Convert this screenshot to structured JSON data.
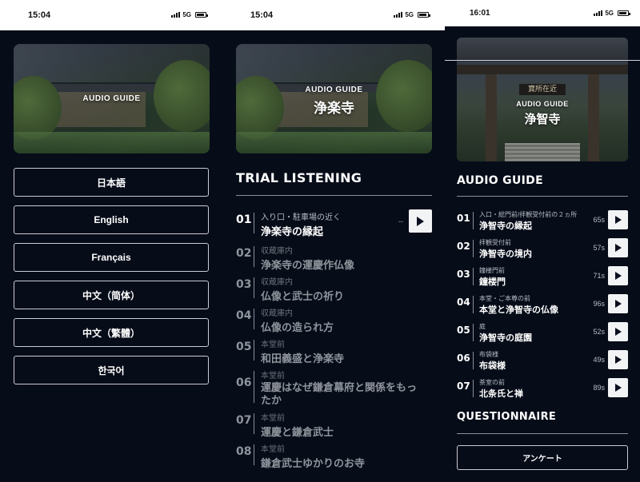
{
  "screen1": {
    "status": {
      "time": "15:04",
      "network": "5G"
    },
    "hero": {
      "label": "AUDIO GUIDE"
    },
    "languages": [
      "日本語",
      "English",
      "Français",
      "中文（简体）",
      "中文（繁體）",
      "한국어"
    ]
  },
  "screen2": {
    "status": {
      "time": "15:04",
      "network": "5G"
    },
    "hero": {
      "label": "AUDIO GUIDE",
      "title": "浄楽寺"
    },
    "section_title": "TRIAL LISTENING",
    "tracks": [
      {
        "num": "01",
        "place": "入り口・駐車場の近く",
        "title": "浄楽寺の縁起",
        "dash": "--"
      },
      {
        "num": "02",
        "place": "収蔵庫内",
        "title": "浄楽寺の運慶作仏像"
      },
      {
        "num": "03",
        "place": "収蔵庫内",
        "title": "仏像と武士の祈り"
      },
      {
        "num": "04",
        "place": "収蔵庫内",
        "title": "仏像の造られ方"
      },
      {
        "num": "05",
        "place": "本堂前",
        "title": "和田義盛と浄楽寺"
      },
      {
        "num": "06",
        "place": "本堂前",
        "title": "運慶はなぜ鎌倉幕府と関係をもったか"
      },
      {
        "num": "07",
        "place": "本堂前",
        "title": "運慶と鎌倉武士"
      },
      {
        "num": "08",
        "place": "本堂前",
        "title": "鎌倉武士ゆかりのお寺"
      }
    ]
  },
  "screen3": {
    "status": {
      "time": "16:01",
      "network": "5G"
    },
    "hero": {
      "label": "AUDIO GUIDE",
      "title": "浄智寺",
      "plaque": "寶所在近"
    },
    "section_title": "AUDIO GUIDE",
    "tracks": [
      {
        "num": "01",
        "place": "入口・総門前/拝観受付前の２ヵ所",
        "title": "浄智寺の縁起",
        "duration": "65s"
      },
      {
        "num": "02",
        "place": "拝観受付前",
        "title": "浄智寺の境内",
        "duration": "57s"
      },
      {
        "num": "03",
        "place": "鐘楼門前",
        "title": "鐘楼門",
        "duration": "71s"
      },
      {
        "num": "04",
        "place": "本堂・ご本尊の前",
        "title": "本堂と浄智寺の仏像",
        "duration": "96s"
      },
      {
        "num": "05",
        "place": "庭",
        "title": "浄智寺の庭園",
        "duration": "52s"
      },
      {
        "num": "06",
        "place": "布袋様",
        "title": "布袋様",
        "duration": "49s"
      },
      {
        "num": "07",
        "place": "茶室の前",
        "title": "北条氏と禅",
        "duration": "89s"
      }
    ],
    "questionnaire_title": "QUESTIONNAIRE",
    "survey_label": "アンケート"
  },
  "colors": {
    "background": "#060c18",
    "text": "#ffffff",
    "button_bg": "#f2f3f5",
    "border": "#c9cdd4"
  },
  "icons": [
    "signal-icon",
    "battery-icon",
    "play-icon"
  ]
}
